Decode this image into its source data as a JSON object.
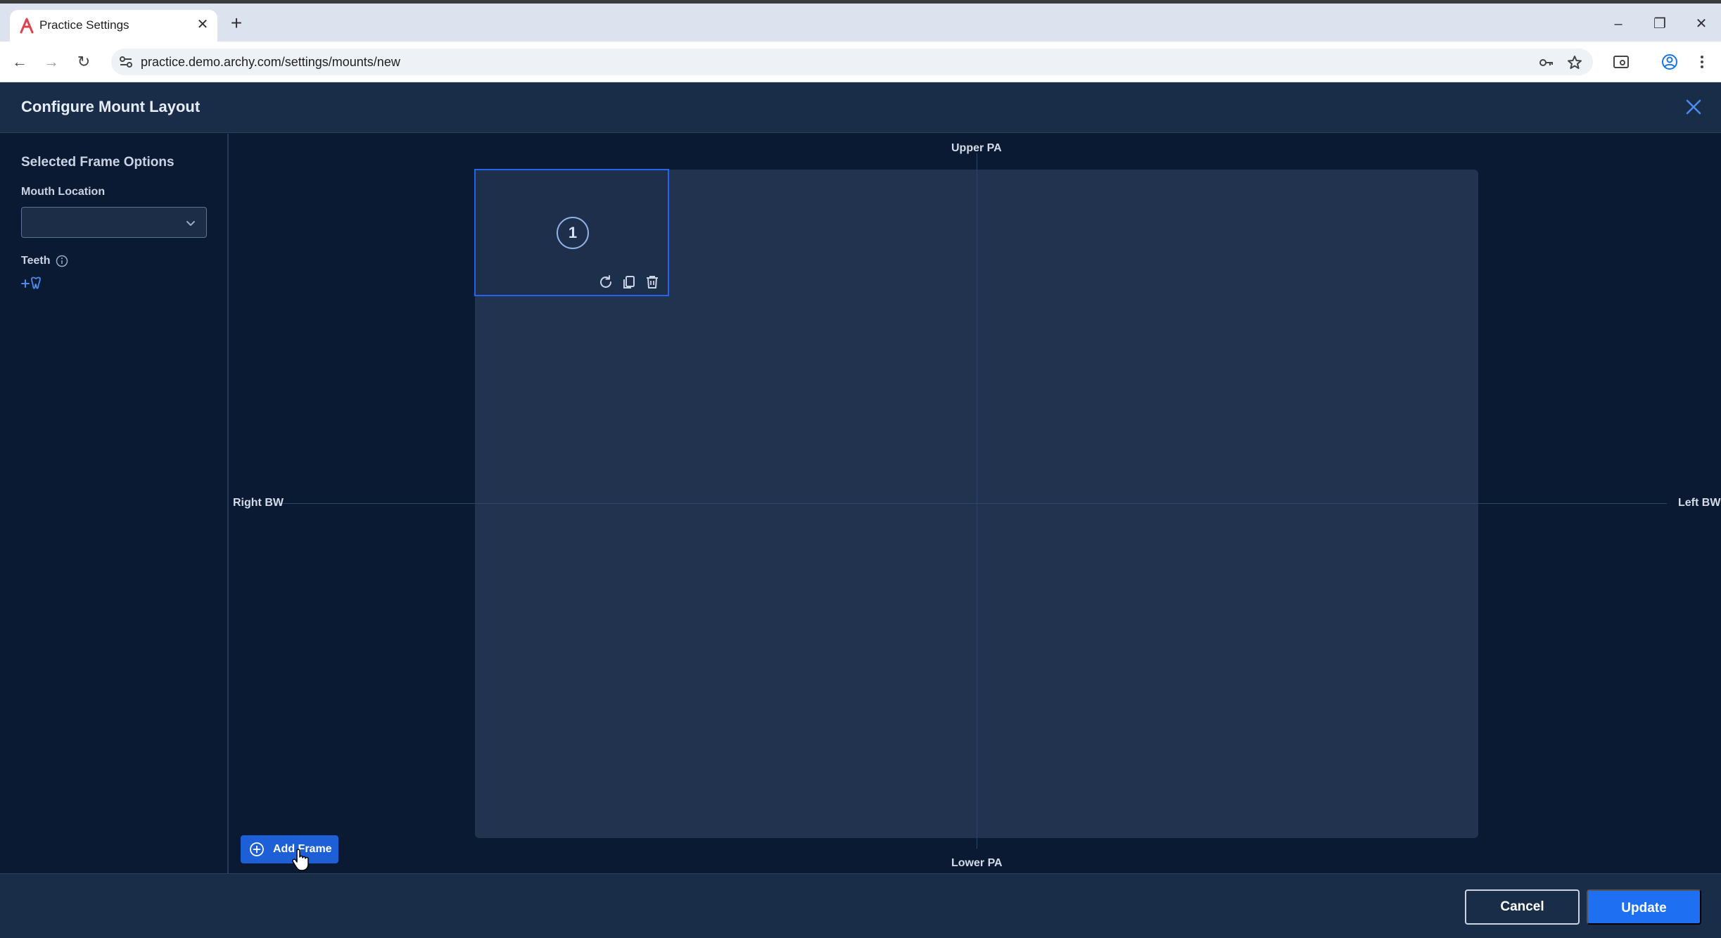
{
  "browser": {
    "tab_title": "Practice Settings",
    "url": "practice.demo.archy.com/settings/mounts/new"
  },
  "app": {
    "header_title": "Configure Mount Layout",
    "sidebar": {
      "heading": "Selected Frame Options",
      "mouth_location_label": "Mouth Location",
      "mouth_location_value": "",
      "teeth_label": "Teeth"
    },
    "canvas": {
      "label_top": "Upper PA",
      "label_bottom": "Lower PA",
      "label_left": "Right BW",
      "label_right": "Left BW",
      "frames": [
        {
          "number": "1"
        }
      ]
    },
    "add_frame_label": "Add Frame",
    "footer": {
      "cancel_label": "Cancel",
      "update_label": "Update"
    }
  },
  "colors": {
    "accent": "#1f6ff2",
    "background": "#0b1a33",
    "panel": "#1a2d48",
    "board": "#223350"
  }
}
